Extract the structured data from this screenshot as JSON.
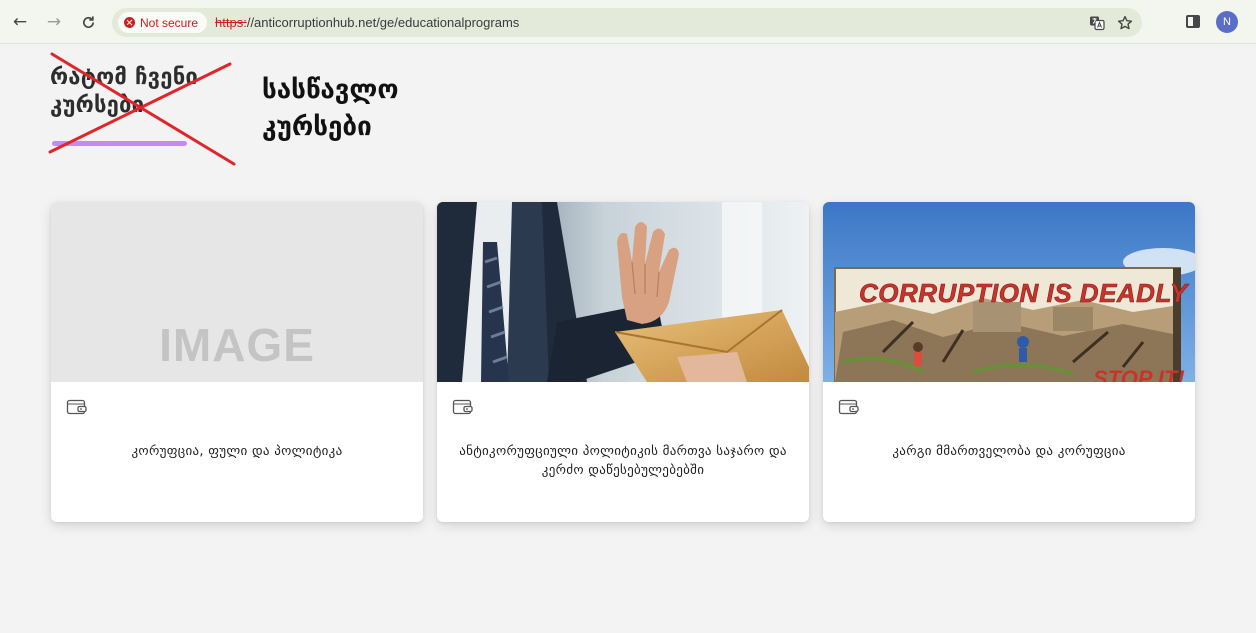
{
  "browser": {
    "security_label": "Not secure",
    "url_scheme": "https:",
    "url_rest": "//anticorruptionhub.net/ge/educationalprograms",
    "profile_initial": "N"
  },
  "heading": {
    "crossed_line1": "რატომ ჩვენი",
    "crossed_line2": "კურსები",
    "new_line1": "სასწავლო",
    "new_line2": "კურსები",
    "accent_color": "#c08cf2",
    "cross_color": "#e0262b"
  },
  "cards": [
    {
      "title": "კორუფცია, ფული და პოლიტიკა",
      "image_text": "IMAGE",
      "icon": "wallet-icon"
    },
    {
      "title": "ანტიკორუფციული პოლიტიკის მართვა საჯარო და კერძო დაწესებულებებში",
      "icon": "wallet-icon"
    },
    {
      "title": "კარგი მმართველობა და კორუფცია",
      "image_text": "CORRUPTION IS DEADLY",
      "image_text_2": "STOP IT!",
      "icon": "wallet-icon"
    }
  ]
}
